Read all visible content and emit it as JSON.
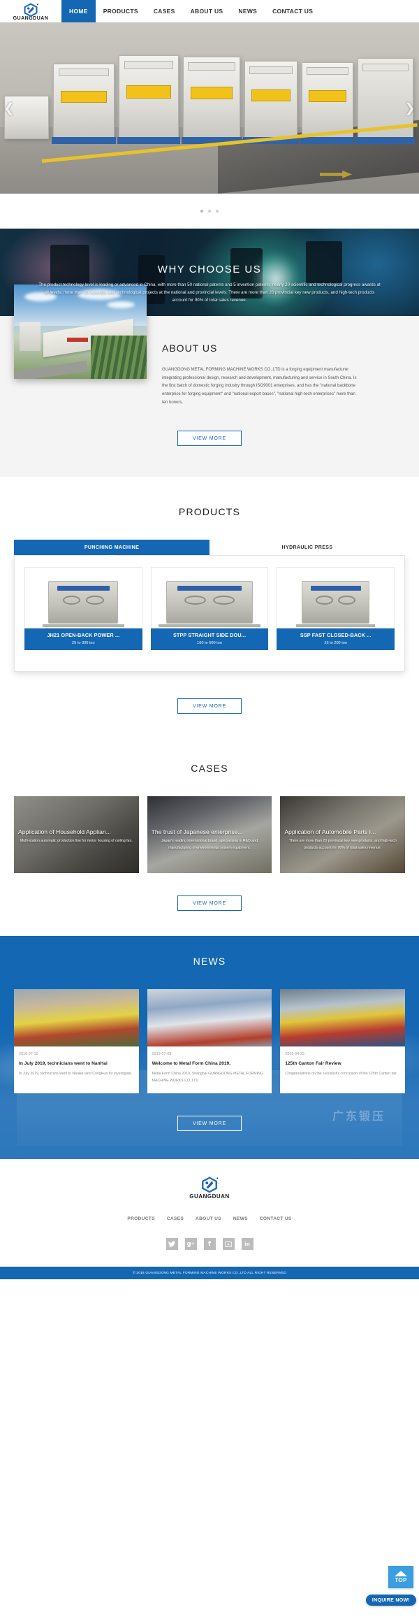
{
  "brand": {
    "name": "GUANGDUAN"
  },
  "nav": {
    "items": [
      {
        "label": "HOME",
        "active": true
      },
      {
        "label": "PRODUCTS",
        "active": false
      },
      {
        "label": "CASES",
        "active": false
      },
      {
        "label": "ABOUT US",
        "active": false
      },
      {
        "label": "NEWS",
        "active": false
      },
      {
        "label": "CONTACT US",
        "active": false
      }
    ]
  },
  "hero": {
    "prev_icon": "chevron-left-icon",
    "next_icon": "chevron-right-icon",
    "slide_count": 3,
    "active_slide": 1
  },
  "why": {
    "title": "WHY CHOOSE US",
    "text": "The product technology level is leading or advanced in China, with more than 50 national patents and 5 invention patents; nearly 20 scientific and technological progress awards at all levels; more than 30 scientific and technological projects at the national and provincial levels; There are more than 20 provincial key new products, and high-tech products account for 90% of total sales revenue."
  },
  "about": {
    "title": "ABOUT US",
    "text": "GUANGDONG METAL FORMING MACHINE WORKS CO.,LTD is a forging equipment manufacturer integrating professional design, research and development, manufacturing and service in South China. Is the first batch of domestic forging industry through ISO9001 enterprises, and has the \"national backbone enterprise for forging equipment\" and \"national export bases\", \"national high-tech enterprises\" more than ten honors.",
    "view_more": "VIEW MORE"
  },
  "products": {
    "title": "PRODUCTS",
    "tabs": [
      {
        "label": "PUNCHING MACHINE",
        "active": true
      },
      {
        "label": "HYDRAULIC PRESS",
        "active": false
      }
    ],
    "items": [
      {
        "name": "JH21 OPEN-BACK POWER ...",
        "spec": "25 to 300 ton"
      },
      {
        "name": "STPP STRAIGHT SIDE DOU...",
        "spec": "160 to 600 ton"
      },
      {
        "name": "SSP FAST CLOSED-BACK ...",
        "spec": "25 to 200 ton"
      }
    ],
    "view_more": "VIEW MORE"
  },
  "cases": {
    "title": "CASES",
    "items": [
      {
        "title": "Application of Household Applian...",
        "desc": "Multi-station automatic production line for motor housing of ceiling fan."
      },
      {
        "title": "The trust of Japanese enterprise...",
        "desc": "Japan's leading international brand, specializing in R&D and manufacturing of environmental system equipment."
      },
      {
        "title": "Application of Automobile Parts I...",
        "desc": "There are more than 20 provincial key new products, and high-tech products account for 90% of total sales revenue."
      }
    ],
    "view_more": "VIEW MORE"
  },
  "news": {
    "title": "NEWS",
    "items": [
      {
        "date": "2019-07-15",
        "title": "In July 2019, technicians went to NanHai",
        "desc": "In July 2019, technicians went to NanHai and CongHua for investigate."
      },
      {
        "date": "2019-07-09",
        "title": "Welcome to Metal Form China 2019,",
        "desc": "Metal Form China 2019, Shanghai GUANGDONG METAL FORMING MACHINE WORKS CO.,LTD."
      },
      {
        "date": "2019-04-25",
        "title": "125th Canton Fair Review",
        "desc": "Congratulations on the successful conclusion of the 125th Canton fair."
      }
    ],
    "view_more": "VIEW MORE"
  },
  "footer": {
    "nav": [
      {
        "label": "PRODUCTS"
      },
      {
        "label": "CASES"
      },
      {
        "label": "ABOUT US"
      },
      {
        "label": "NEWS"
      },
      {
        "label": "CONTACT US"
      }
    ],
    "socials": [
      {
        "name": "twitter-icon",
        "glyph": "ᴠ"
      },
      {
        "name": "google-plus-icon",
        "glyph": "g"
      },
      {
        "name": "facebook-icon",
        "glyph": "f"
      },
      {
        "name": "youtube-icon",
        "glyph": "▶"
      },
      {
        "name": "linkedin-icon",
        "glyph": "in"
      }
    ],
    "copyright": "© 2018 GUANGDONG METAL FORMING MACHINE WORKS CO.,LTD ALL RIGHT RESERVED"
  },
  "widgets": {
    "top_label": "TOP",
    "inquire_label": "INQUIRE NOW!"
  },
  "colors": {
    "brand_blue": "#1467b3",
    "light_blue": "#3a9ee0",
    "page_bg": "#ffffff",
    "section_bg": "#f4f4f4"
  }
}
